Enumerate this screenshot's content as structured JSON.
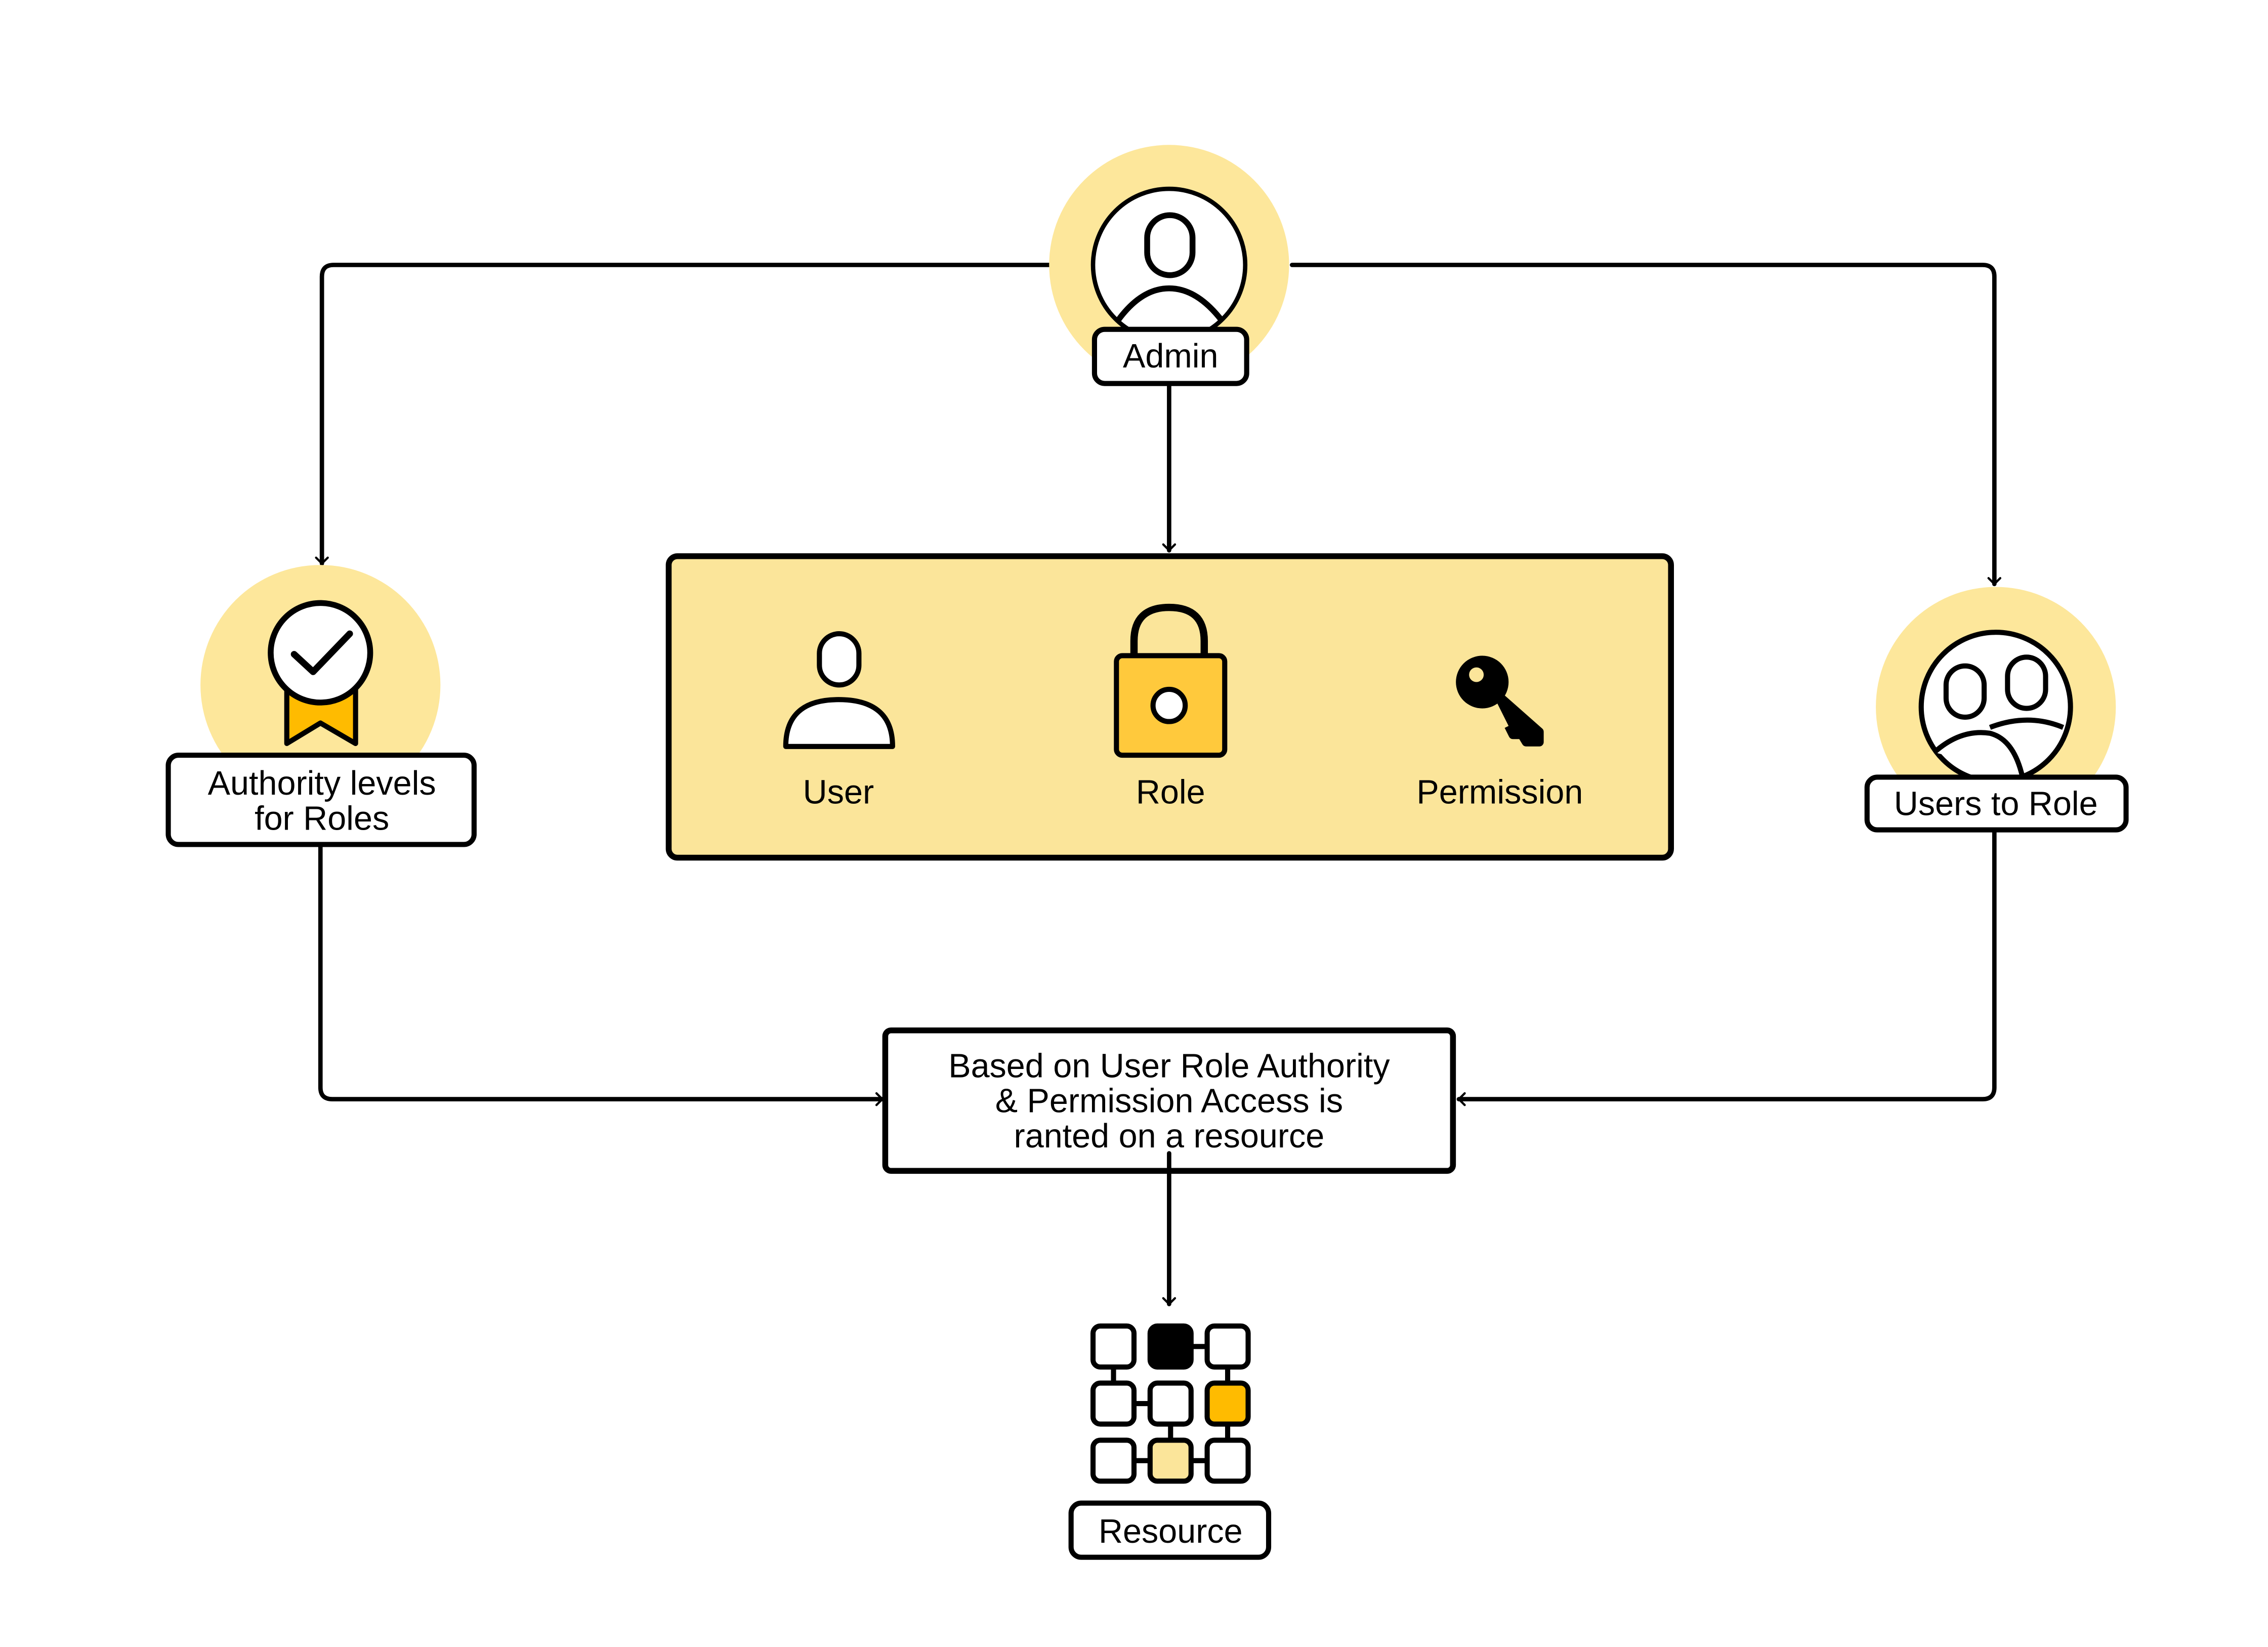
{
  "colors": {
    "halo": "#FDE79B",
    "panel": "#FBE59A",
    "gold": "#FFBB00",
    "lock": "#FFC93C",
    "light_cell": "#FBE59A",
    "stroke": "#000000"
  },
  "nodes": {
    "admin": {
      "label": "Admin",
      "icon": "user-circle-icon"
    },
    "authority": {
      "label_line1": "Authority levels",
      "label_line2": "for Roles",
      "icon": "award-badge-icon"
    },
    "users_to_role": {
      "label": "Users to Role",
      "icon": "users-group-icon"
    },
    "panel": {
      "items": [
        {
          "label": "User",
          "icon": "user-icon"
        },
        {
          "label": "Role",
          "icon": "lock-icon"
        },
        {
          "label": "Permission",
          "icon": "key-icon"
        }
      ]
    },
    "decision": {
      "line1": "Based on User Role Authority",
      "line2": "& Permission Access is",
      "line3": "ranted on a resource"
    },
    "resource": {
      "label": "Resource",
      "icon": "resource-grid-icon"
    }
  }
}
